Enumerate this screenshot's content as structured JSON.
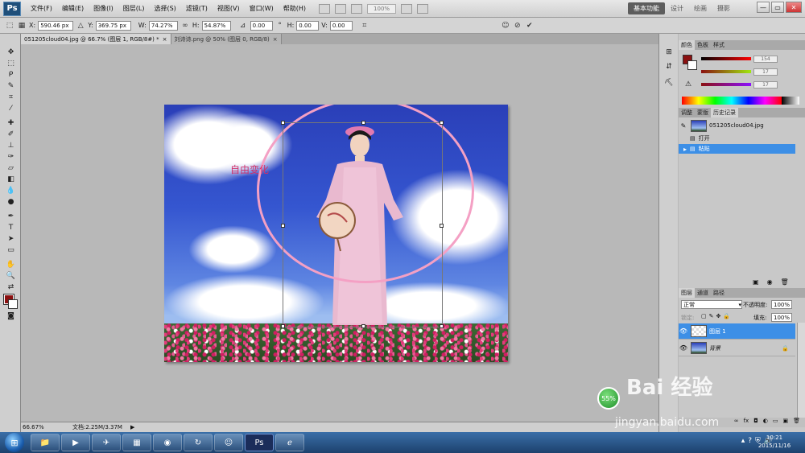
{
  "app": {
    "logo": "Ps"
  },
  "menu": [
    "文件(F)",
    "编辑(E)",
    "图像(I)",
    "图层(L)",
    "选择(S)",
    "滤镜(T)",
    "视图(V)",
    "窗口(W)",
    "帮助(H)"
  ],
  "menubar": {
    "zoom_display": "100%",
    "workspace_active": "基本功能",
    "workspace_links": [
      "设计",
      "绘画",
      "摄影"
    ],
    "window_controls": [
      "—",
      "▭",
      "✕"
    ]
  },
  "options": {
    "x_label": "X:",
    "x_value": "590.46 px",
    "y_label": "Y:",
    "y_value": "369.75 px",
    "w_label": "W:",
    "w_value": "74.27%",
    "h_label": "H:",
    "h_value": "54.87%",
    "angle_value": "0.00",
    "hskew_label": "H:",
    "hskew_value": "0.00",
    "vskew_label": "V:",
    "vskew_value": "0.00"
  },
  "tabs": [
    {
      "label": "051205cloud04.jpg @ 66.7% (图层 1, RGB/8#) *",
      "close": "×"
    },
    {
      "label": "刘诗诗.png @ 50% (图层 0, RGB/8)",
      "close": "×"
    }
  ],
  "canvas": {
    "annotation": "自由变化"
  },
  "status": {
    "zoom": "66.67%",
    "doc_size": "文档:2.25M/3.37M"
  },
  "color_panel": {
    "tabs": [
      "颜色",
      "色板",
      "样式"
    ],
    "r": "154",
    "g": "17",
    "b": "17",
    "fg_color": "#8b1010"
  },
  "history_panel": {
    "tabs": [
      "调整",
      "蒙版",
      "历史记录"
    ],
    "snapshot": "051205cloud04.jpg",
    "steps": [
      "打开",
      "粘贴"
    ]
  },
  "layers_panel": {
    "tabs": [
      "图层",
      "通道",
      "路径"
    ],
    "blend_mode": "正常",
    "opacity_label": "不透明度:",
    "opacity": "100%",
    "lock_label": "锁定:",
    "fill_label": "填充:",
    "fill": "100%",
    "layers": [
      "图层 1",
      "背景"
    ]
  },
  "watermark": {
    "logo": "Bai  经验",
    "url": "jingyan.baidu.com",
    "progress": "55%"
  },
  "taskbar": {
    "time": "10:21",
    "date": "2015/11/16"
  }
}
